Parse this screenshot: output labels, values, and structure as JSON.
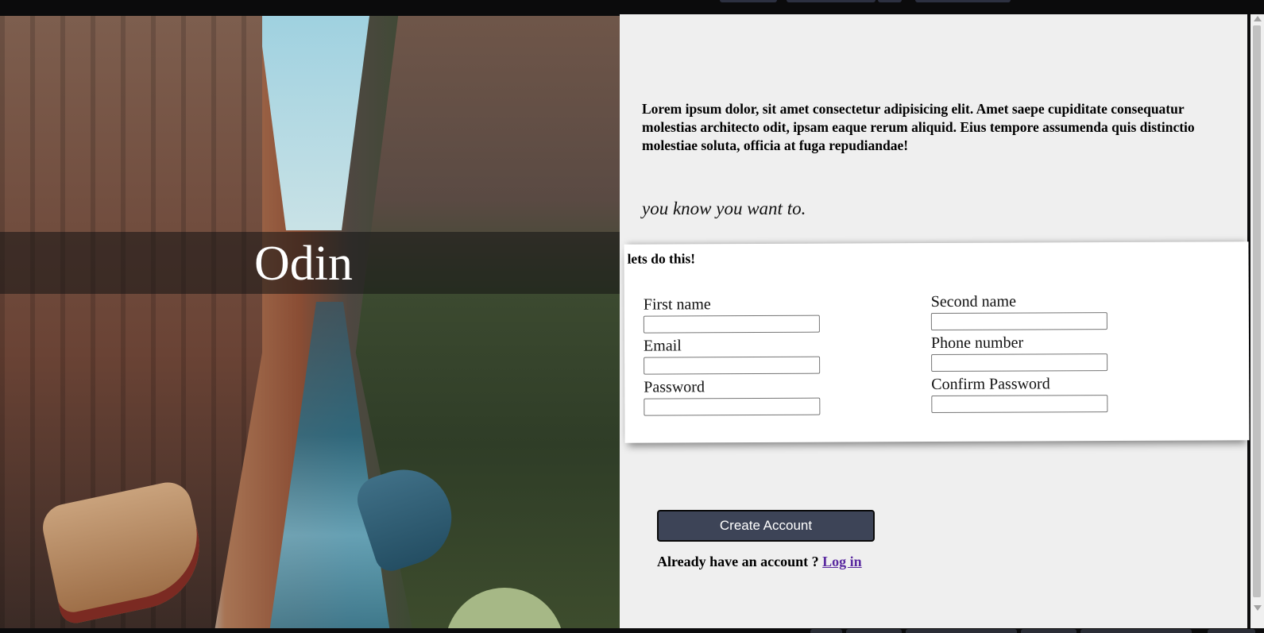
{
  "hero": {
    "logo": "Odin"
  },
  "intro": {
    "text": "Lorem ipsum dolor, sit amet consectetur adipisicing elit. Amet saepe cupiditate consequatur molestias architecto odit, ipsam eaque rerum aliquid. Eius tempore assumenda quis distinctio molestiae soluta, officia at fuga repudiandae!",
    "tagline": "you know you want to."
  },
  "form": {
    "title": "lets do this!",
    "fields": [
      {
        "label": "First name",
        "value": ""
      },
      {
        "label": "Second name",
        "value": ""
      },
      {
        "label": "Email",
        "value": ""
      },
      {
        "label": "Phone number",
        "value": ""
      },
      {
        "label": "Password",
        "value": ""
      },
      {
        "label": "Confirm Password",
        "value": ""
      }
    ]
  },
  "actions": {
    "create_label": "Create Account",
    "login_prompt": "Already have an account ?",
    "login_link": "Log in"
  },
  "colors": {
    "button_bg": "#3d4457",
    "content_bg": "#efefef",
    "link": "#5a2aa0"
  }
}
